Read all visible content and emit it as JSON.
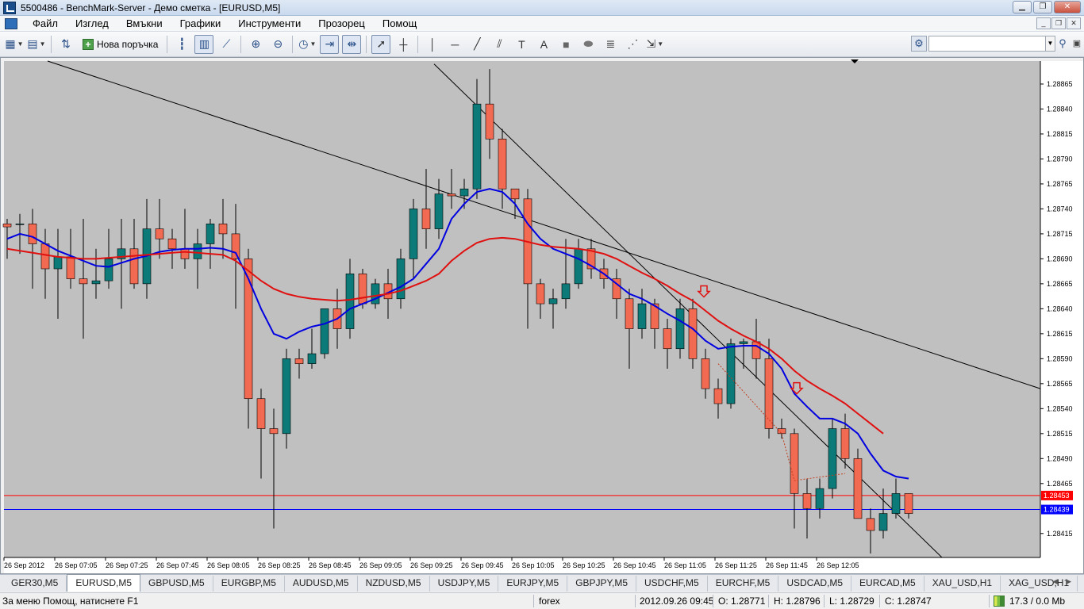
{
  "window": {
    "title": "5500486 - BenchMark-Server - Демо сметка - [EURUSD,M5]"
  },
  "menu": {
    "items": [
      "Файл",
      "Изглед",
      "Вмъкни",
      "Графики",
      "Инструменти",
      "Прозорец",
      "Помощ"
    ]
  },
  "toolbar": {
    "new_order_label": "Нова поръчка",
    "search_placeholder": ""
  },
  "tabs": {
    "items": [
      "GER30,M5",
      "EURUSD,M5",
      "GBPUSD,M5",
      "EURGBP,M5",
      "AUDUSD,M5",
      "NZDUSD,M5",
      "USDJPY,M5",
      "EURJPY,M5",
      "GBPJPY,M5",
      "USDCHF,M5",
      "EURCHF,M5",
      "USDCAD,M5",
      "EURCAD,M5",
      "XAU_USD,H1",
      "XAG_USD,H1"
    ],
    "active_index": 1
  },
  "status": {
    "help": "За меню Помощ, натиснете F1",
    "profile": "forex",
    "datetime": "2012.09.26 09:45",
    "open": "O: 1.28771",
    "high": "H: 1.28796",
    "low": "L: 1.28729",
    "close": "C: 1.28747",
    "traffic": "17.3 / 0.0 Mb"
  },
  "colors": {
    "chart_bg": "#c0c0c0",
    "bull": "#0d7a7a",
    "bear": "#f36a52",
    "ma_fast": "#0000e0",
    "ma_slow": "#e01010",
    "bid_line": "#ff0000",
    "ask_line": "#0000ff"
  },
  "chart_data": {
    "type": "candlestick",
    "symbol": "EURUSD",
    "timeframe": "M5",
    "ylim": [
      1.28391,
      1.28888
    ],
    "y_ticks": [
      "1.28865",
      "1.28840",
      "1.28815",
      "1.28790",
      "1.28765",
      "1.28740",
      "1.28715",
      "1.28690",
      "1.28665",
      "1.28640",
      "1.28615",
      "1.28590",
      "1.28565",
      "1.28540",
      "1.28515",
      "1.28490",
      "1.28465",
      "1.28415"
    ],
    "x_ticks": [
      "26 Sep 2012",
      "26 Sep 07:05",
      "26 Sep 07:25",
      "26 Sep 07:45",
      "26 Sep 08:05",
      "26 Sep 08:25",
      "26 Sep 08:45",
      "26 Sep 09:05",
      "26 Sep 09:25",
      "26 Sep 09:45",
      "26 Sep 10:05",
      "26 Sep 10:25",
      "26 Sep 10:45",
      "26 Sep 11:05",
      "26 Sep 11:25",
      "26 Sep 11:45",
      "26 Sep 12:05"
    ],
    "bid_price": "1.28453",
    "ask_price": "1.28439",
    "bid_value": 1.28453,
    "ask_value": 1.28439,
    "candles": [
      [
        1.28725,
        1.2873,
        1.2869,
        1.28722
      ],
      [
        1.28725,
        1.28735,
        1.28695,
        1.28725
      ],
      [
        1.28725,
        1.2874,
        1.2866,
        1.28705
      ],
      [
        1.28705,
        1.2872,
        1.2865,
        1.2868
      ],
      [
        1.2868,
        1.2872,
        1.2863,
        1.28692
      ],
      [
        1.28692,
        1.2872,
        1.2866,
        1.2867
      ],
      [
        1.2867,
        1.2873,
        1.2861,
        1.28665
      ],
      [
        1.28665,
        1.287,
        1.2865,
        1.28668
      ],
      [
        1.28668,
        1.2872,
        1.2866,
        1.2869
      ],
      [
        1.2869,
        1.2873,
        1.2864,
        1.287
      ],
      [
        1.287,
        1.2873,
        1.2866,
        1.28665
      ],
      [
        1.28665,
        1.2875,
        1.2865,
        1.2872
      ],
      [
        1.2872,
        1.2875,
        1.2869,
        1.2871
      ],
      [
        1.2871,
        1.2872,
        1.2868,
        1.287
      ],
      [
        1.287,
        1.2874,
        1.2868,
        1.2869
      ],
      [
        1.2869,
        1.2872,
        1.2866,
        1.28705
      ],
      [
        1.28705,
        1.2873,
        1.2868,
        1.28725
      ],
      [
        1.28725,
        1.2875,
        1.2869,
        1.28715
      ],
      [
        1.28715,
        1.28745,
        1.2864,
        1.2869
      ],
      [
        1.2869,
        1.287,
        1.2852,
        1.2855
      ],
      [
        1.2855,
        1.2856,
        1.2847,
        1.2852
      ],
      [
        1.2852,
        1.2854,
        1.2842,
        1.28515
      ],
      [
        1.28515,
        1.286,
        1.285,
        1.2859
      ],
      [
        1.2859,
        1.286,
        1.2857,
        1.28585
      ],
      [
        1.28585,
        1.2862,
        1.2858,
        1.28595
      ],
      [
        1.28595,
        1.2864,
        1.2859,
        1.2864
      ],
      [
        1.2864,
        1.2866,
        1.286,
        1.2862
      ],
      [
        1.2862,
        1.2869,
        1.2861,
        1.28675
      ],
      [
        1.28675,
        1.2868,
        1.2864,
        1.28645
      ],
      [
        1.28645,
        1.2867,
        1.2864,
        1.28665
      ],
      [
        1.28665,
        1.2868,
        1.2863,
        1.2865
      ],
      [
        1.2865,
        1.287,
        1.2864,
        1.2869
      ],
      [
        1.2869,
        1.2875,
        1.2867,
        1.2874
      ],
      [
        1.2874,
        1.2878,
        1.287,
        1.2872
      ],
      [
        1.2872,
        1.2877,
        1.2871,
        1.28755
      ],
      [
        1.28755,
        1.2878,
        1.2874,
        1.28753
      ],
      [
        1.28753,
        1.2877,
        1.2874,
        1.2876
      ],
      [
        1.2876,
        1.2887,
        1.2875,
        1.28845
      ],
      [
        1.28845,
        1.2888,
        1.2879,
        1.2881
      ],
      [
        1.2881,
        1.2882,
        1.2874,
        1.2876
      ],
      [
        1.2876,
        1.2876,
        1.2873,
        1.2875
      ],
      [
        1.2875,
        1.2876,
        1.2862,
        1.28665
      ],
      [
        1.28665,
        1.2867,
        1.2863,
        1.28645
      ],
      [
        1.28645,
        1.2866,
        1.2862,
        1.2865
      ],
      [
        1.2865,
        1.2871,
        1.2864,
        1.28665
      ],
      [
        1.28665,
        1.2871,
        1.2866,
        1.287
      ],
      [
        1.287,
        1.2871,
        1.2867,
        1.2868
      ],
      [
        1.2868,
        1.2869,
        1.2866,
        1.2867
      ],
      [
        1.2867,
        1.2868,
        1.2863,
        1.2865
      ],
      [
        1.2865,
        1.2866,
        1.2858,
        1.2862
      ],
      [
        1.2862,
        1.2866,
        1.2861,
        1.28645
      ],
      [
        1.28645,
        1.2865,
        1.286,
        1.2862
      ],
      [
        1.2862,
        1.2863,
        1.2858,
        1.286
      ],
      [
        1.286,
        1.2865,
        1.2859,
        1.2864
      ],
      [
        1.2864,
        1.2865,
        1.2858,
        1.2859
      ],
      [
        1.2859,
        1.286,
        1.2855,
        1.2856
      ],
      [
        1.2856,
        1.2857,
        1.2853,
        1.28545
      ],
      [
        1.28545,
        1.2861,
        1.2854,
        1.28605
      ],
      [
        1.28605,
        1.2861,
        1.2858,
        1.28607
      ],
      [
        1.28607,
        1.2863,
        1.2857,
        1.2859
      ],
      [
        1.2859,
        1.2861,
        1.2851,
        1.2852
      ],
      [
        1.2852,
        1.2853,
        1.2851,
        1.28515
      ],
      [
        1.28515,
        1.2852,
        1.2842,
        1.28455
      ],
      [
        1.28455,
        1.2847,
        1.2841,
        1.2844
      ],
      [
        1.2844,
        1.2847,
        1.2843,
        1.2846
      ],
      [
        1.2846,
        1.2853,
        1.2845,
        1.2852
      ],
      [
        1.2852,
        1.28535,
        1.2848,
        1.2849
      ],
      [
        1.2849,
        1.285,
        1.2843,
        1.2843
      ],
      [
        1.2843,
        1.2844,
        1.28395,
        1.28418
      ],
      [
        1.28418,
        1.2846,
        1.2841,
        1.28435
      ],
      [
        1.28435,
        1.2847,
        1.2843,
        1.28455
      ],
      [
        1.28455,
        1.28455,
        1.2843,
        1.28435
      ]
    ],
    "ma_fast": [
      1.2871,
      1.28715,
      1.28712,
      1.28705,
      1.28698,
      1.28693,
      1.28688,
      1.28683,
      1.28682,
      1.28686,
      1.2869,
      1.28693,
      1.28697,
      1.28699,
      1.287,
      1.287,
      1.28701,
      1.287,
      1.28696,
      1.2867,
      1.2864,
      1.28615,
      1.2861,
      1.28617,
      1.28622,
      1.28625,
      1.2863,
      1.2864,
      1.28645,
      1.2865,
      1.28656,
      1.28662,
      1.2867,
      1.28685,
      1.287,
      1.2873,
      1.28745,
      1.28757,
      1.2876,
      1.28757,
      1.28745,
      1.28725,
      1.2871,
      1.287,
      1.28695,
      1.2869,
      1.28683,
      1.28675,
      1.28665,
      1.28655,
      1.2865,
      1.28643,
      1.28635,
      1.28628,
      1.2862,
      1.28608,
      1.286,
      1.28602,
      1.28603,
      1.28603,
      1.28595,
      1.2858,
      1.28555,
      1.28542,
      1.2853,
      1.2853,
      1.28525,
      1.28515,
      1.28495,
      1.28478,
      1.28472,
      1.2847
    ],
    "ma_slow": [
      1.287,
      1.28698,
      1.28696,
      1.28694,
      1.28692,
      1.28691,
      1.2869,
      1.2869,
      1.28691,
      1.28692,
      1.28693,
      1.28694,
      1.28695,
      1.28696,
      1.28697,
      1.28696,
      1.28695,
      1.28694,
      1.28688,
      1.28678,
      1.28668,
      1.2866,
      1.28655,
      1.28652,
      1.2865,
      1.28649,
      1.28648,
      1.28649,
      1.28651,
      1.28653,
      1.28655,
      1.28658,
      1.28663,
      1.28668,
      1.28675,
      1.28688,
      1.28698,
      1.28706,
      1.2871,
      1.28711,
      1.2871,
      1.28707,
      1.28704,
      1.28702,
      1.28701,
      1.287,
      1.28698,
      1.28695,
      1.2869,
      1.28683,
      1.28676,
      1.2867,
      1.28663,
      1.28655,
      1.28648,
      1.28638,
      1.28628,
      1.2862,
      1.28613,
      1.28607,
      1.286,
      1.2859,
      1.28578,
      1.28568,
      1.2856,
      1.28553,
      1.28545,
      1.28535,
      1.28525,
      1.28515
    ]
  }
}
